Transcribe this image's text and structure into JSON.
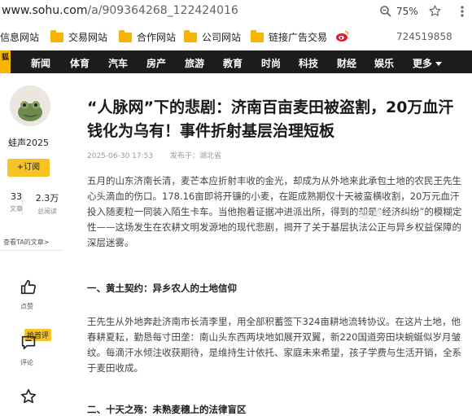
{
  "browser": {
    "url_host": "www.sohu.com",
    "url_path": "/a/909364268_122424016",
    "zoom": "75%"
  },
  "bookmarks": {
    "items": [
      "信息网站",
      "交易网站",
      "合作网站",
      "公司网站",
      "链接广告交易"
    ],
    "number": "724519858"
  },
  "nav": {
    "logo": "狐",
    "items": [
      "新闻",
      "体育",
      "汽车",
      "房产",
      "旅游",
      "教育",
      "时尚",
      "科技",
      "财经",
      "娱乐"
    ],
    "more": "更多"
  },
  "sidebar": {
    "author": "蛙声2025",
    "follow_label": "+订阅",
    "articles_count": "33",
    "articles_label": "文章",
    "views_count": "2.3万",
    "views_label": "总阅读",
    "view_all": "查看TA的文章>",
    "like_label": "点赞",
    "comment_badge": "抢首评",
    "comment_label": "评论"
  },
  "article": {
    "title": "“人脉网”下的悲剧：济南百亩麦田被盗割，20万血汗钱化为乌有！事件折射基层治理短板",
    "date": "2025-06-30 17:53",
    "location": "发布于：湖北省",
    "watermark": "蛙声",
    "paragraphs": [
      "五月的山东济南长清，麦芒本应折射丰收的金光，却成为从外地来此承包土地的农民王先生心头滴血的伤口。178.16亩即将开镰的小麦，在距成熟期仅十天被蛮横收割，20万元血汗投入随麦粒一同装入陌生卡车。当他抱着证据冲进派出所，得到的却是“经济纠纷”的模糊定性——这场发生在农耕文明发源地的现代悲剧，揭开了关于基层执法公正与异乡权益保障的深层迷雾。",
      "王先生从外地奔赴济南市长清李里，用全部积蓄签下324亩耕地流转协议。在这片土地，他春耕夏耘，勤恳每寸田垄：南山头东西两块地如展开双翼，新220国道旁田块蜿蜒似岁月皱纹。每滴汗水倾注收获期待，是维持生计依托、家庭未来希望，孩子学费与生活开销，全系于麦田收成。"
    ],
    "section1": "一、黄土契约：异乡农人的土地信仰",
    "section2": "二、十天之殇：未熟麦穗上的法律盲区"
  }
}
